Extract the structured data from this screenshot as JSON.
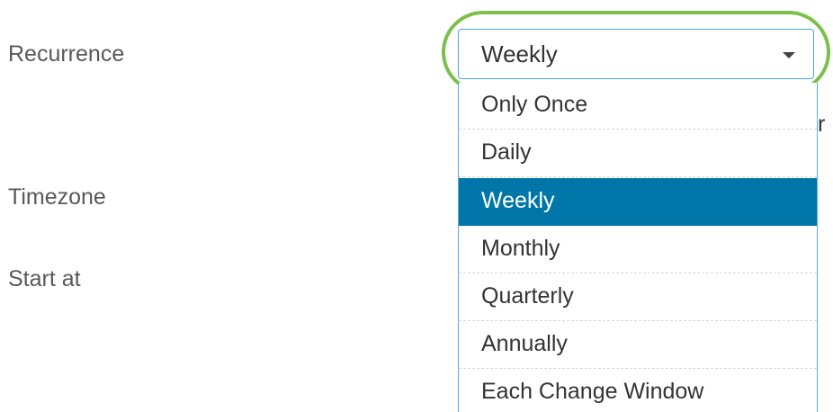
{
  "form": {
    "labels": {
      "recurrence": "Recurrence",
      "timezone": "Timezone",
      "start_at": "Start at"
    },
    "clipped_fragment": "r"
  },
  "recurrence_select": {
    "selected_value": "Weekly",
    "options": [
      {
        "label": "Only Once",
        "selected": false
      },
      {
        "label": "Daily",
        "selected": false
      },
      {
        "label": "Weekly",
        "selected": true
      },
      {
        "label": "Monthly",
        "selected": false
      },
      {
        "label": "Quarterly",
        "selected": false
      },
      {
        "label": "Annually",
        "selected": false
      },
      {
        "label": "Each Change Window",
        "selected": false
      }
    ],
    "icon": "caret-down-icon"
  },
  "colors": {
    "selected_option_bg": "#0077a8",
    "select_border": "#4aa8d8",
    "highlight_ring": "#7cc04b",
    "label_text": "#595959"
  }
}
